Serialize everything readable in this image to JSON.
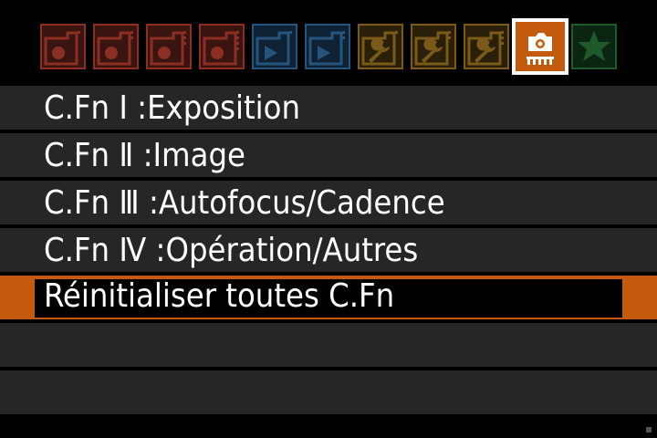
{
  "tabs": [
    {
      "icon": "camera-shooting-red-1-icon",
      "color": "#8a2f22"
    },
    {
      "icon": "camera-shooting-red-2-icon",
      "color": "#8a2f22"
    },
    {
      "icon": "camera-shooting-red-3-icon",
      "color": "#8a2f22"
    },
    {
      "icon": "camera-shooting-red-4-icon",
      "color": "#8a2f22"
    },
    {
      "icon": "playback-blue-1-icon",
      "color": "#25557c"
    },
    {
      "icon": "playback-blue-2-icon",
      "color": "#25557c"
    },
    {
      "icon": "wrench-setup-1-icon",
      "color": "#7a5a18"
    },
    {
      "icon": "wrench-setup-2-icon",
      "color": "#7a5a18"
    },
    {
      "icon": "wrench-setup-3-icon",
      "color": "#7a5a18"
    },
    {
      "icon": "custom-functions-camera-icon",
      "color": "#c45a0e",
      "selected": true
    },
    {
      "icon": "my-menu-star-icon",
      "color": "#1e5a2a"
    }
  ],
  "menu": {
    "items": [
      {
        "label": "C.Fn Ⅰ :Exposition"
      },
      {
        "label": "C.Fn Ⅱ :Image"
      },
      {
        "label": "C.Fn Ⅲ :Autofocus/Cadence"
      },
      {
        "label": "C.Fn Ⅳ :Opération/Autres"
      },
      {
        "label": "Réinitialiser toutes C.Fn",
        "selected": true
      },
      {
        "label": ""
      },
      {
        "label": ""
      }
    ]
  },
  "colors": {
    "accent": "#c45a0e",
    "row_background": "#262626",
    "text": "#ffffff"
  }
}
